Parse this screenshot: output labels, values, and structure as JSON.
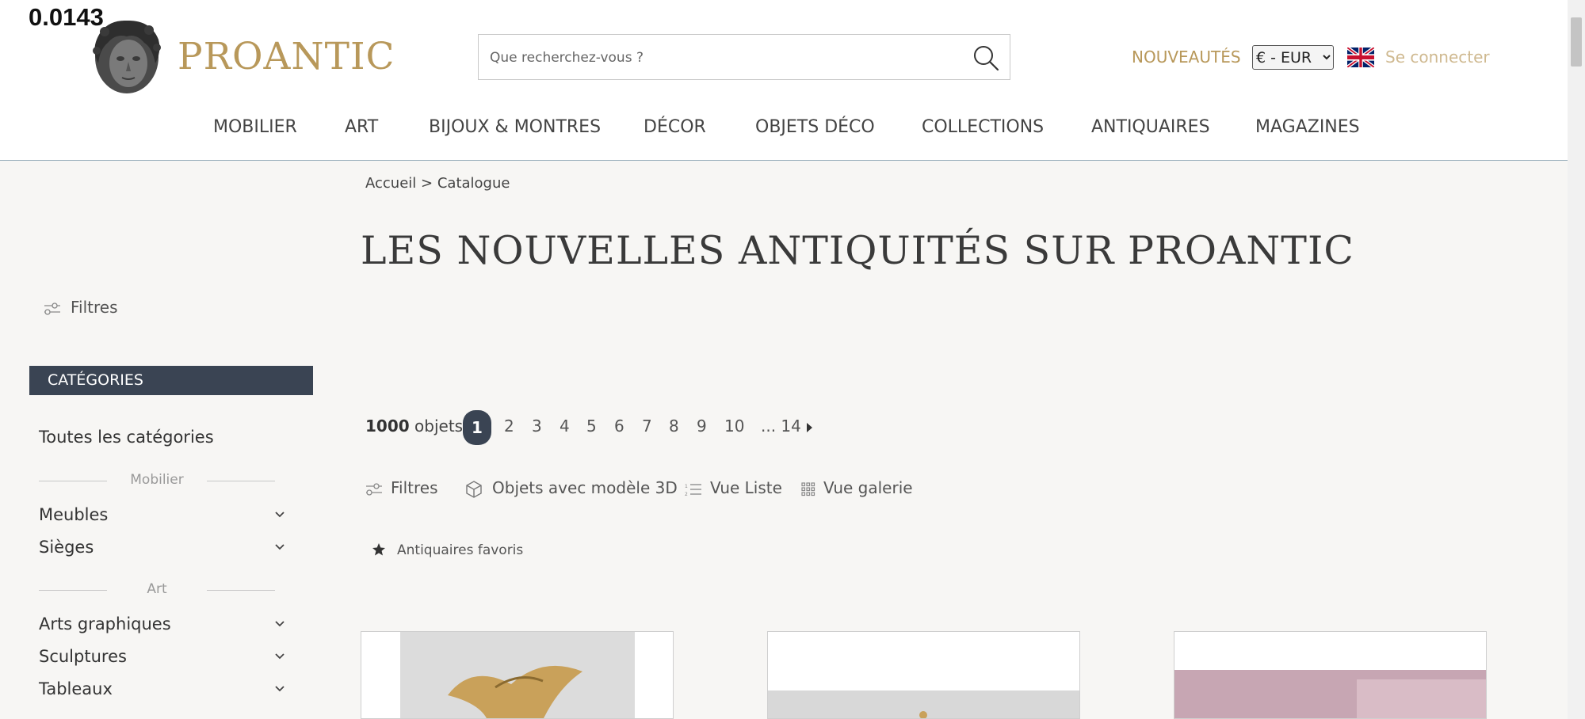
{
  "overlay": {
    "readout": "0.0143"
  },
  "header": {
    "logo_text": "PROANTIC",
    "search_placeholder": "Que recherchez-vous ?",
    "new_label": "NOUVEAUTÉS",
    "currency": {
      "selected": "€ - EUR",
      "options": [
        "€ - EUR"
      ]
    },
    "flag_icon": "uk-flag-icon",
    "login_label": "Se connecter",
    "accent_color": "#b8985a"
  },
  "nav": {
    "items": [
      "MOBILIER",
      "ART",
      "BIJOUX & MONTRES",
      "DÉCOR",
      "OBJETS DÉCO",
      "COLLECTIONS",
      "ANTIQUAIRES",
      "MAGAZINES"
    ]
  },
  "breadcrumb": {
    "home": "Accueil",
    "separator": ">",
    "current": "Catalogue"
  },
  "page_title": "LES NOUVELLES ANTIQUITÉS SUR PROANTIC",
  "sidebar": {
    "filters_label": "Filtres",
    "categories_header": "CATÉGORIES",
    "header_color": "#3a4453",
    "all_label": "Toutes les catégories",
    "groups": [
      {
        "title": "Mobilier",
        "items": [
          "Meubles",
          "Sièges"
        ]
      },
      {
        "title": "Art",
        "items": [
          "Arts graphiques",
          "Sculptures",
          "Tableaux"
        ]
      }
    ]
  },
  "pagination": {
    "count": "1000",
    "count_suffix": "objets",
    "current": "1",
    "pages": [
      "2",
      "3",
      "4",
      "5",
      "6",
      "7",
      "8",
      "9",
      "10"
    ],
    "ellipsis_last": "... 14"
  },
  "toolbar": {
    "filters": "Filtres",
    "models_3d": "Objets avec modèle 3D",
    "list_view": "Vue Liste",
    "gallery_view": "Vue galerie",
    "favorites": "Antiquaires favoris"
  }
}
